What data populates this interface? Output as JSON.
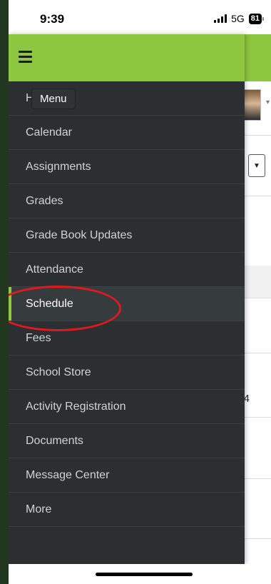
{
  "status_bar": {
    "time": "9:39",
    "network": "5G",
    "battery": "81"
  },
  "menu": {
    "tooltip": "Menu",
    "items": [
      {
        "label": "Home"
      },
      {
        "label": "Calendar"
      },
      {
        "label": "Assignments"
      },
      {
        "label": "Grades"
      },
      {
        "label": "Grade Book Updates"
      },
      {
        "label": "Attendance"
      },
      {
        "label": "Schedule",
        "active": true
      },
      {
        "label": "Fees"
      },
      {
        "label": "School Store"
      },
      {
        "label": "Activity Registration"
      },
      {
        "label": "Documents"
      },
      {
        "label": "Message Center"
      },
      {
        "label": "More"
      }
    ]
  },
  "background": {
    "number_fragment": "4"
  },
  "colors": {
    "accent": "#8dc63f",
    "drawer": "#2b2f31",
    "annotation": "#e0191f"
  },
  "icons": [
    "hamburger-menu-icon",
    "signal-icon",
    "battery-icon",
    "chevron-down-icon"
  ]
}
